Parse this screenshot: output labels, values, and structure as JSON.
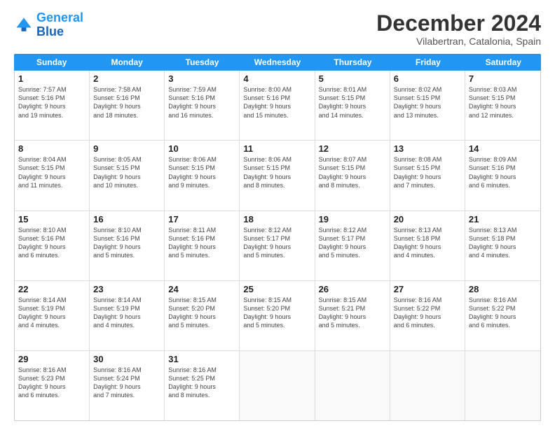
{
  "logo": {
    "line1": "General",
    "line2": "Blue"
  },
  "title": "December 2024",
  "subtitle": "Vilabertran, Catalonia, Spain",
  "header_days": [
    "Sunday",
    "Monday",
    "Tuesday",
    "Wednesday",
    "Thursday",
    "Friday",
    "Saturday"
  ],
  "weeks": [
    [
      {
        "day": "1",
        "lines": [
          "Sunrise: 7:57 AM",
          "Sunset: 5:16 PM",
          "Daylight: 9 hours",
          "and 19 minutes."
        ]
      },
      {
        "day": "2",
        "lines": [
          "Sunrise: 7:58 AM",
          "Sunset: 5:16 PM",
          "Daylight: 9 hours",
          "and 18 minutes."
        ]
      },
      {
        "day": "3",
        "lines": [
          "Sunrise: 7:59 AM",
          "Sunset: 5:16 PM",
          "Daylight: 9 hours",
          "and 16 minutes."
        ]
      },
      {
        "day": "4",
        "lines": [
          "Sunrise: 8:00 AM",
          "Sunset: 5:16 PM",
          "Daylight: 9 hours",
          "and 15 minutes."
        ]
      },
      {
        "day": "5",
        "lines": [
          "Sunrise: 8:01 AM",
          "Sunset: 5:15 PM",
          "Daylight: 9 hours",
          "and 14 minutes."
        ]
      },
      {
        "day": "6",
        "lines": [
          "Sunrise: 8:02 AM",
          "Sunset: 5:15 PM",
          "Daylight: 9 hours",
          "and 13 minutes."
        ]
      },
      {
        "day": "7",
        "lines": [
          "Sunrise: 8:03 AM",
          "Sunset: 5:15 PM",
          "Daylight: 9 hours",
          "and 12 minutes."
        ]
      }
    ],
    [
      {
        "day": "8",
        "lines": [
          "Sunrise: 8:04 AM",
          "Sunset: 5:15 PM",
          "Daylight: 9 hours",
          "and 11 minutes."
        ]
      },
      {
        "day": "9",
        "lines": [
          "Sunrise: 8:05 AM",
          "Sunset: 5:15 PM",
          "Daylight: 9 hours",
          "and 10 minutes."
        ]
      },
      {
        "day": "10",
        "lines": [
          "Sunrise: 8:06 AM",
          "Sunset: 5:15 PM",
          "Daylight: 9 hours",
          "and 9 minutes."
        ]
      },
      {
        "day": "11",
        "lines": [
          "Sunrise: 8:06 AM",
          "Sunset: 5:15 PM",
          "Daylight: 9 hours",
          "and 8 minutes."
        ]
      },
      {
        "day": "12",
        "lines": [
          "Sunrise: 8:07 AM",
          "Sunset: 5:15 PM",
          "Daylight: 9 hours",
          "and 8 minutes."
        ]
      },
      {
        "day": "13",
        "lines": [
          "Sunrise: 8:08 AM",
          "Sunset: 5:15 PM",
          "Daylight: 9 hours",
          "and 7 minutes."
        ]
      },
      {
        "day": "14",
        "lines": [
          "Sunrise: 8:09 AM",
          "Sunset: 5:16 PM",
          "Daylight: 9 hours",
          "and 6 minutes."
        ]
      }
    ],
    [
      {
        "day": "15",
        "lines": [
          "Sunrise: 8:10 AM",
          "Sunset: 5:16 PM",
          "Daylight: 9 hours",
          "and 6 minutes."
        ]
      },
      {
        "day": "16",
        "lines": [
          "Sunrise: 8:10 AM",
          "Sunset: 5:16 PM",
          "Daylight: 9 hours",
          "and 5 minutes."
        ]
      },
      {
        "day": "17",
        "lines": [
          "Sunrise: 8:11 AM",
          "Sunset: 5:16 PM",
          "Daylight: 9 hours",
          "and 5 minutes."
        ]
      },
      {
        "day": "18",
        "lines": [
          "Sunrise: 8:12 AM",
          "Sunset: 5:17 PM",
          "Daylight: 9 hours",
          "and 5 minutes."
        ]
      },
      {
        "day": "19",
        "lines": [
          "Sunrise: 8:12 AM",
          "Sunset: 5:17 PM",
          "Daylight: 9 hours",
          "and 5 minutes."
        ]
      },
      {
        "day": "20",
        "lines": [
          "Sunrise: 8:13 AM",
          "Sunset: 5:18 PM",
          "Daylight: 9 hours",
          "and 4 minutes."
        ]
      },
      {
        "day": "21",
        "lines": [
          "Sunrise: 8:13 AM",
          "Sunset: 5:18 PM",
          "Daylight: 9 hours",
          "and 4 minutes."
        ]
      }
    ],
    [
      {
        "day": "22",
        "lines": [
          "Sunrise: 8:14 AM",
          "Sunset: 5:19 PM",
          "Daylight: 9 hours",
          "and 4 minutes."
        ]
      },
      {
        "day": "23",
        "lines": [
          "Sunrise: 8:14 AM",
          "Sunset: 5:19 PM",
          "Daylight: 9 hours",
          "and 4 minutes."
        ]
      },
      {
        "day": "24",
        "lines": [
          "Sunrise: 8:15 AM",
          "Sunset: 5:20 PM",
          "Daylight: 9 hours",
          "and 5 minutes."
        ]
      },
      {
        "day": "25",
        "lines": [
          "Sunrise: 8:15 AM",
          "Sunset: 5:20 PM",
          "Daylight: 9 hours",
          "and 5 minutes."
        ]
      },
      {
        "day": "26",
        "lines": [
          "Sunrise: 8:15 AM",
          "Sunset: 5:21 PM",
          "Daylight: 9 hours",
          "and 5 minutes."
        ]
      },
      {
        "day": "27",
        "lines": [
          "Sunrise: 8:16 AM",
          "Sunset: 5:22 PM",
          "Daylight: 9 hours",
          "and 6 minutes."
        ]
      },
      {
        "day": "28",
        "lines": [
          "Sunrise: 8:16 AM",
          "Sunset: 5:22 PM",
          "Daylight: 9 hours",
          "and 6 minutes."
        ]
      }
    ],
    [
      {
        "day": "29",
        "lines": [
          "Sunrise: 8:16 AM",
          "Sunset: 5:23 PM",
          "Daylight: 9 hours",
          "and 6 minutes."
        ]
      },
      {
        "day": "30",
        "lines": [
          "Sunrise: 8:16 AM",
          "Sunset: 5:24 PM",
          "Daylight: 9 hours",
          "and 7 minutes."
        ]
      },
      {
        "day": "31",
        "lines": [
          "Sunrise: 8:16 AM",
          "Sunset: 5:25 PM",
          "Daylight: 9 hours",
          "and 8 minutes."
        ]
      },
      {
        "day": "",
        "lines": []
      },
      {
        "day": "",
        "lines": []
      },
      {
        "day": "",
        "lines": []
      },
      {
        "day": "",
        "lines": []
      }
    ]
  ]
}
